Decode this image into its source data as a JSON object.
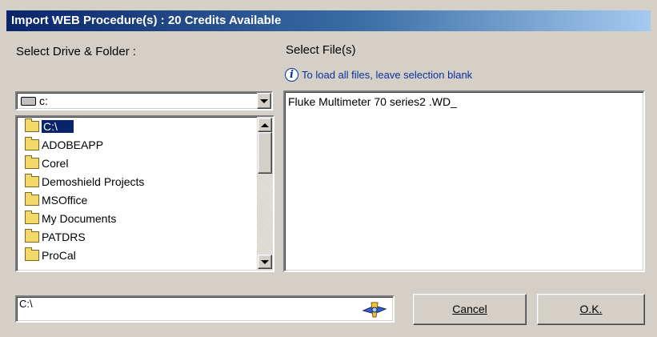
{
  "title": "Import WEB Procedure(s) : 20 Credits Available",
  "left_label": "Select Drive & Folder :",
  "right_label": "Select File(s)",
  "info_text": "To load all files, leave selection blank",
  "drive": {
    "value": "c:"
  },
  "folders": [
    {
      "name": "C:\\",
      "selected": true
    },
    {
      "name": "ADOBEAPP"
    },
    {
      "name": "Corel"
    },
    {
      "name": "Demoshield Projects"
    },
    {
      "name": "MSOffice"
    },
    {
      "name": "My Documents"
    },
    {
      "name": "PATDRS"
    },
    {
      "name": "ProCal"
    }
  ],
  "files": [
    "Fluke Multimeter 70 series2 .WD_"
  ],
  "path_value": "C:\\",
  "buttons": {
    "cancel": "Cancel",
    "ok": "O.K."
  },
  "colors": {
    "title_start": "#0a246a",
    "title_end": "#a6caf0",
    "info": "#0b2f9c"
  }
}
